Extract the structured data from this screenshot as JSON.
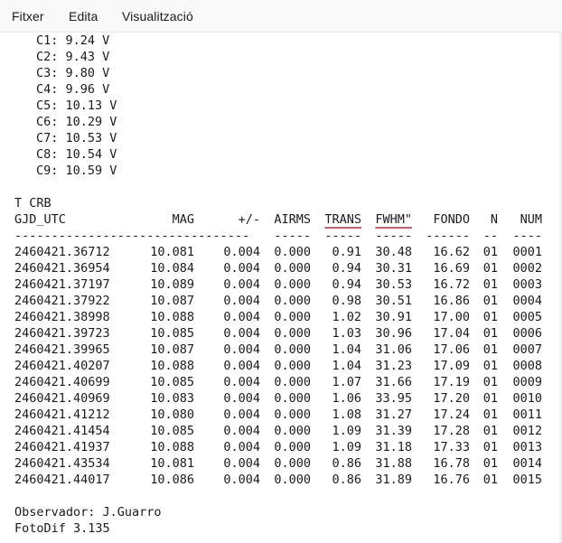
{
  "menu": {
    "file": "Fitxer",
    "edit": "Edita",
    "view": "Visualització"
  },
  "channels": [
    "C1: 9.24 V",
    "C2: 9.43 V",
    "C3: 9.80 V",
    "C4: 9.96 V",
    "C5: 10.13 V",
    "C6: 10.29 V",
    "C7: 10.53 V",
    "C8: 10.54 V",
    "C9: 10.59 V"
  ],
  "star": "T CRB",
  "headers": {
    "gjd": "GJD_UTC",
    "mag": "MAG",
    "err": "+/-",
    "airms": "AIRMS",
    "trans": "TRANS",
    "fwhm": "FWHM\"",
    "fondo": "FONDO",
    "n": "N",
    "num": "NUM"
  },
  "separators": {
    "gjd": "--------------------------------",
    "mag": "",
    "err": "",
    "airms": "-----",
    "trans": "-----",
    "fwhm": "-----",
    "fondo": "------",
    "n": "--",
    "num": "----"
  },
  "rows": [
    [
      "2460421.36712",
      "10.081",
      "0.004",
      "0.000",
      "0.91",
      "30.48",
      "16.62",
      "01",
      "0001"
    ],
    [
      "2460421.36954",
      "10.084",
      "0.004",
      "0.000",
      "0.94",
      "30.31",
      "16.69",
      "01",
      "0002"
    ],
    [
      "2460421.37197",
      "10.089",
      "0.004",
      "0.000",
      "0.94",
      "30.53",
      "16.72",
      "01",
      "0003"
    ],
    [
      "2460421.37922",
      "10.087",
      "0.004",
      "0.000",
      "0.98",
      "30.51",
      "16.86",
      "01",
      "0004"
    ],
    [
      "2460421.38998",
      "10.088",
      "0.004",
      "0.000",
      "1.02",
      "30.91",
      "17.00",
      "01",
      "0005"
    ],
    [
      "2460421.39723",
      "10.085",
      "0.004",
      "0.000",
      "1.03",
      "30.96",
      "17.04",
      "01",
      "0006"
    ],
    [
      "2460421.39965",
      "10.087",
      "0.004",
      "0.000",
      "1.04",
      "31.06",
      "17.06",
      "01",
      "0007"
    ],
    [
      "2460421.40207",
      "10.088",
      "0.004",
      "0.000",
      "1.04",
      "31.23",
      "17.09",
      "01",
      "0008"
    ],
    [
      "2460421.40699",
      "10.085",
      "0.004",
      "0.000",
      "1.07",
      "31.66",
      "17.19",
      "01",
      "0009"
    ],
    [
      "2460421.40969",
      "10.083",
      "0.004",
      "0.000",
      "1.06",
      "33.95",
      "17.20",
      "01",
      "0010"
    ],
    [
      "2460421.41212",
      "10.080",
      "0.004",
      "0.000",
      "1.08",
      "31.27",
      "17.24",
      "01",
      "0011"
    ],
    [
      "2460421.41454",
      "10.085",
      "0.004",
      "0.000",
      "1.09",
      "31.39",
      "17.28",
      "01",
      "0012"
    ],
    [
      "2460421.41937",
      "10.088",
      "0.004",
      "0.000",
      "1.09",
      "31.18",
      "17.33",
      "01",
      "0013"
    ],
    [
      "2460421.43534",
      "10.081",
      "0.004",
      "0.000",
      "0.86",
      "31.88",
      "16.78",
      "01",
      "0014"
    ],
    [
      "2460421.44017",
      "10.086",
      "0.004",
      "0.000",
      "0.86",
      "31.89",
      "16.76",
      "01",
      "0015"
    ]
  ],
  "footer": {
    "observer": "Observador: J.Guarro",
    "software": "FotoDif 3.135"
  }
}
